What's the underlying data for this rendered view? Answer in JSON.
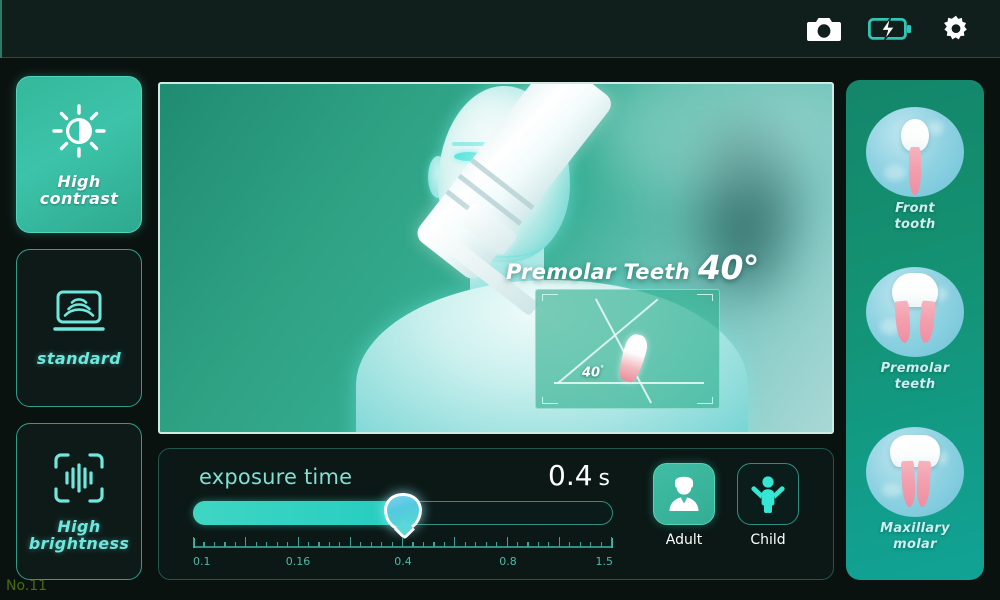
{
  "topbar": {
    "icons": [
      {
        "name": "camera-icon",
        "label": "Camera"
      },
      {
        "name": "battery-charging-icon",
        "label": "Battery charging"
      },
      {
        "name": "gear-icon",
        "label": "Settings"
      }
    ]
  },
  "left_rail": {
    "modes": [
      {
        "id": "high-contrast",
        "label": "High\ncontrast",
        "line1": "High",
        "line2": "contrast",
        "icon": "contrast-sun-icon",
        "active": true
      },
      {
        "id": "standard",
        "label": "standard",
        "line1": "standard",
        "line2": "",
        "icon": "display-wave-icon",
        "active": false
      },
      {
        "id": "high-brightness",
        "label": "High\nbrightness",
        "line1": "High",
        "line2": "brightness",
        "icon": "brightness-scan-icon",
        "active": false
      }
    ]
  },
  "viewport": {
    "caption_text": "Premolar Teeth",
    "caption_angle": "40°",
    "inset": {
      "angle_value": "40",
      "angle_unit": "°"
    }
  },
  "exposure": {
    "label": "exposure time",
    "value": "0.4",
    "unit": "s",
    "slider": {
      "percent": 50,
      "min_label": "0.1",
      "max_label": "1.5"
    },
    "ruler_labels": [
      {
        "text": "0.1",
        "pos": 0
      },
      {
        "text": "0.16",
        "pos": 25
      },
      {
        "text": "0.4",
        "pos": 50
      },
      {
        "text": "0.8",
        "pos": 75
      },
      {
        "text": "1.5",
        "pos": 100
      }
    ]
  },
  "patient_types": [
    {
      "id": "adult",
      "label": "Adult",
      "icon": "adult-person-icon",
      "active": true
    },
    {
      "id": "child",
      "label": "Child",
      "icon": "child-person-icon",
      "active": false
    }
  ],
  "right_rail": {
    "items": [
      {
        "id": "front-tooth",
        "line1": "Front",
        "line2": "tooth",
        "icon": "front-tooth-icon",
        "active": false
      },
      {
        "id": "premolar-teeth",
        "line1": "Premolar",
        "line2": "teeth",
        "icon": "premolar-tooth-icon",
        "active": true
      },
      {
        "id": "maxillary-molar",
        "line1": "Maxillary",
        "line2": "molar",
        "icon": "maxillary-molar-icon",
        "active": false
      }
    ]
  },
  "serial": "No.11",
  "colors": {
    "accent_teal": "#3fd6c3",
    "panel_bg": "#0b1816",
    "rail_green": "#149172",
    "text_white": "#ffffff",
    "serial_olive": "#4a6b0f"
  }
}
